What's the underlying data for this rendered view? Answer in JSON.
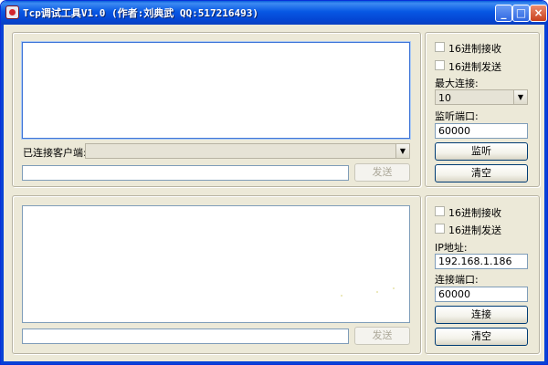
{
  "window": {
    "title": "Tcp调试工具V1.0 (作者:刘典武 QQ:517216493)",
    "minimize_glyph": "_",
    "maximize_glyph": "□",
    "close_glyph": "×"
  },
  "server": {
    "hex_receive_label": "16进制接收",
    "hex_send_label": "16进制发送",
    "max_conn_label": "最大连接:",
    "max_conn_value": "10",
    "listen_port_label": "监听端口:",
    "listen_port_value": "60000",
    "listen_button": "监听",
    "clear_button": "清空",
    "clients_label": "已连接客户端:",
    "clients_value": "",
    "send_input_value": "",
    "send_button": "发送"
  },
  "client": {
    "hex_receive_label": "16进制接收",
    "hex_send_label": "16进制发送",
    "ip_label": "IP地址:",
    "ip_value": "192.168.1.186",
    "port_label": "连接端口:",
    "port_value": "60000",
    "connect_button": "连接",
    "clear_button": "清空",
    "send_input_value": "",
    "send_button": "发送"
  }
}
